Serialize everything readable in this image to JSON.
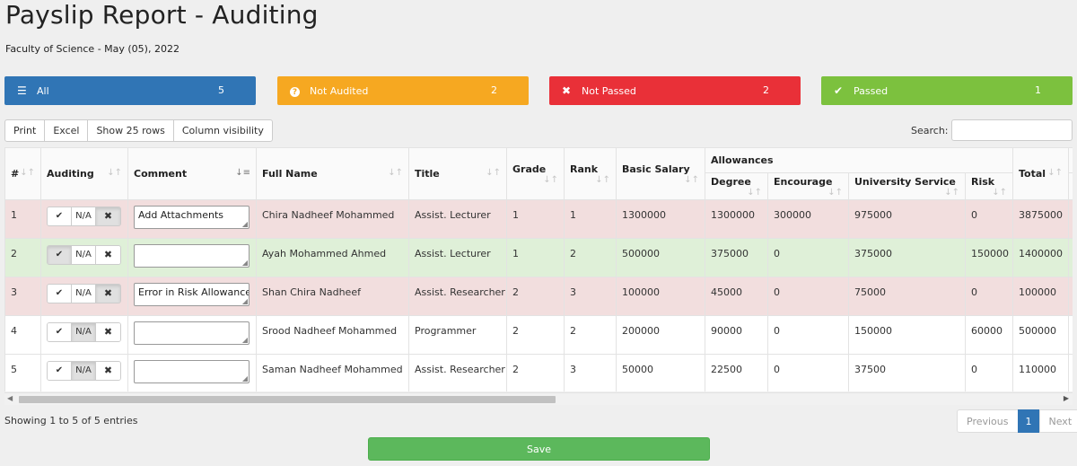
{
  "header": {
    "title": "Payslip Report - Auditing",
    "subtitle": "Faculty of Science - May (05), 2022"
  },
  "stats": {
    "all": {
      "label": "All",
      "count": "5",
      "color": "#3075b5"
    },
    "not_audited": {
      "label": "Not Audited",
      "count": "2",
      "color": "#f6a821"
    },
    "not_passed": {
      "label": "Not Passed",
      "count": "2",
      "color": "#e93038"
    },
    "passed": {
      "label": "Passed",
      "count": "1",
      "color": "#7cc13e"
    }
  },
  "toolbar": {
    "print": "Print",
    "excel": "Excel",
    "show_rows": "Show 25 rows",
    "column_visibility": "Column visibility"
  },
  "search": {
    "label": "Search:",
    "value": ""
  },
  "table": {
    "group_header": "Allowances",
    "columns": {
      "num": "#",
      "auditing": "Auditing",
      "comment": "Comment",
      "full_name": "Full Name",
      "title": "Title",
      "grade": "Grade",
      "rank": "Rank",
      "basic_salary": "Basic Salary",
      "degree": "Degree",
      "encourage": "Encourage",
      "university_service": "University Service",
      "risk": "Risk",
      "total": "Total"
    },
    "auditing_buttons": {
      "check": "✔",
      "na": "N/A",
      "cross": "✖"
    },
    "rows": [
      {
        "num": "1",
        "status": "not_passed",
        "comment": "Add Attachments",
        "full_name": "Chira Nadheef Mohammed",
        "title": "Assist. Lecturer",
        "grade": "1",
        "rank": "1",
        "basic_salary": "1300000",
        "degree": "1300000",
        "encourage": "300000",
        "university_service": "975000",
        "risk": "0",
        "total": "3875000"
      },
      {
        "num": "2",
        "status": "passed",
        "comment": "",
        "full_name": "Ayah Mohammed Ahmed",
        "title": "Assist. Lecturer",
        "grade": "1",
        "rank": "2",
        "basic_salary": "500000",
        "degree": "375000",
        "encourage": "0",
        "university_service": "375000",
        "risk": "150000",
        "total": "1400000"
      },
      {
        "num": "3",
        "status": "not_passed",
        "comment": "Error in Risk Allowance",
        "full_name": "Shan Chira Nadheef",
        "title": "Assist. Researcher",
        "grade": "2",
        "rank": "3",
        "basic_salary": "100000",
        "degree": "45000",
        "encourage": "0",
        "university_service": "75000",
        "risk": "0",
        "total": "100000"
      },
      {
        "num": "4",
        "status": "not_audited",
        "comment": "",
        "full_name": "Srood Nadheef Mohammed",
        "title": "Programmer",
        "grade": "2",
        "rank": "2",
        "basic_salary": "200000",
        "degree": "90000",
        "encourage": "0",
        "university_service": "150000",
        "risk": "60000",
        "total": "500000"
      },
      {
        "num": "5",
        "status": "not_audited",
        "comment": "",
        "full_name": "Saman Nadheef Mohammed",
        "title": "Assist. Researcher",
        "grade": "2",
        "rank": "3",
        "basic_salary": "50000",
        "degree": "22500",
        "encourage": "0",
        "university_service": "37500",
        "risk": "0",
        "total": "110000"
      }
    ]
  },
  "footer": {
    "info": "Showing 1 to 5 of 5 entries",
    "previous": "Previous",
    "current_page": "1",
    "next": "Next",
    "save": "Save"
  }
}
